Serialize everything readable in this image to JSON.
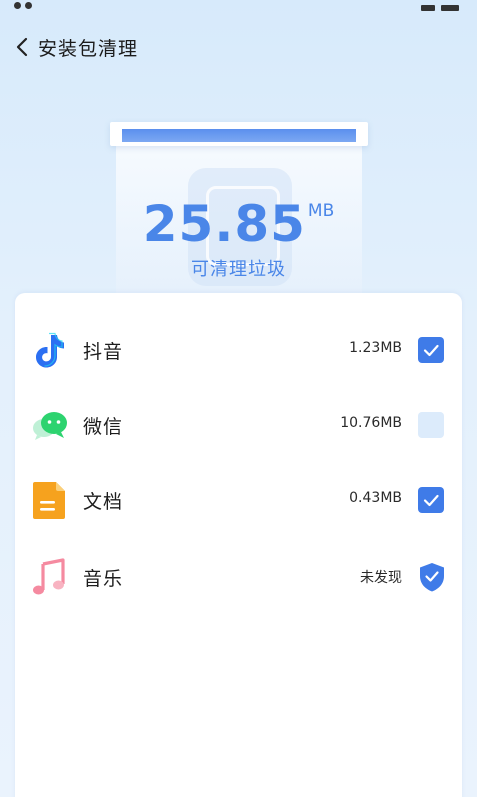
{
  "header": {
    "title": "安装包清理"
  },
  "summary": {
    "size_value": "25.85",
    "size_unit": "MB",
    "caption": "可清理垃圾"
  },
  "items": [
    {
      "name": "抖音",
      "size": "1.23MB",
      "checked": true,
      "icon": "douyin-icon"
    },
    {
      "name": "微信",
      "size": "10.76MB",
      "checked": false,
      "icon": "wechat-icon"
    },
    {
      "name": "文档",
      "size": "0.43MB",
      "checked": true,
      "icon": "document-icon"
    },
    {
      "name": "音乐",
      "size": "未发现",
      "status": "none",
      "icon": "music-icon"
    }
  ],
  "colors": {
    "accent": "#4a86e8",
    "checkbox_on": "#3f7be8",
    "checkbox_off": "#dcebfb",
    "wechat_green": "#2dd36f",
    "doc_orange": "#f6a21e",
    "music_pink": "#f58aa0"
  }
}
